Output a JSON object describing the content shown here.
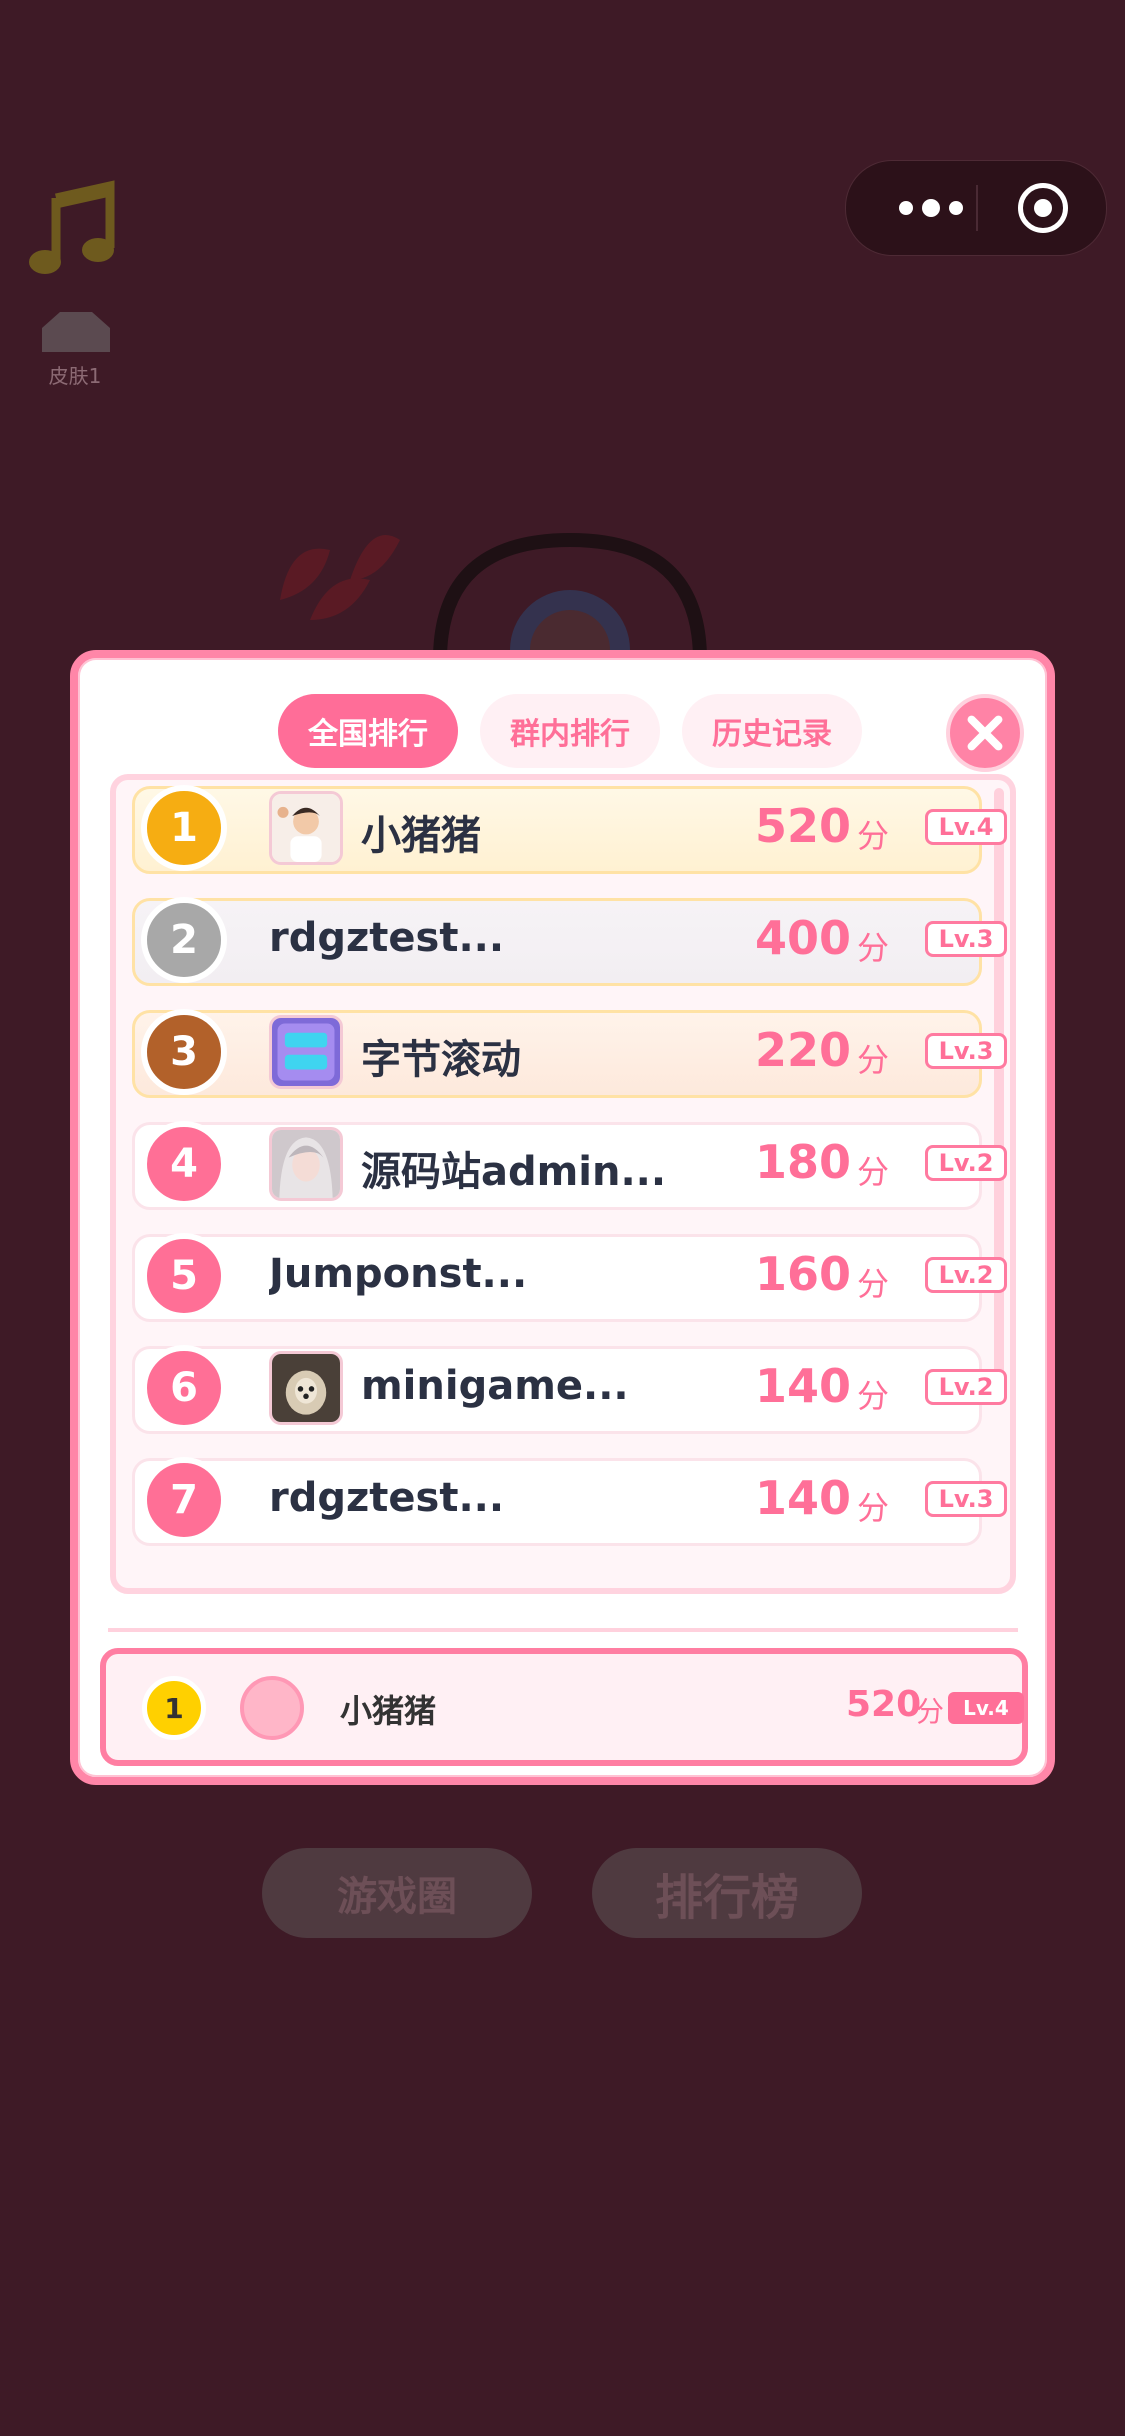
{
  "background": {
    "skin_label": "皮肤1"
  },
  "capsule": {
    "more_icon": "more-dots-icon",
    "close_icon": "target-close-icon"
  },
  "modal": {
    "tabs": [
      {
        "label": "全国排行",
        "active": true
      },
      {
        "label": "群内排行",
        "active": false
      },
      {
        "label": "历史记录",
        "active": false
      }
    ],
    "close_icon": "close-x-icon",
    "score_unit": "分",
    "rows": [
      {
        "rank": "1",
        "name": "小猪猪",
        "score": "520",
        "level": "Lv.4",
        "has_avatar": true
      },
      {
        "rank": "2",
        "name": "rdgztest...",
        "score": "400",
        "level": "Lv.3",
        "has_avatar": false
      },
      {
        "rank": "3",
        "name": "字节滚动",
        "score": "220",
        "level": "Lv.3",
        "has_avatar": true
      },
      {
        "rank": "4",
        "name": "源码站admin...",
        "score": "180",
        "level": "Lv.2",
        "has_avatar": true
      },
      {
        "rank": "5",
        "name": "Jumponst...",
        "score": "160",
        "level": "Lv.2",
        "has_avatar": false
      },
      {
        "rank": "6",
        "name": "minigame...",
        "score": "140",
        "level": "Lv.2",
        "has_avatar": true
      },
      {
        "rank": "7",
        "name": "rdgztest...",
        "score": "140",
        "level": "Lv.3",
        "has_avatar": false
      }
    ],
    "my_rank": {
      "rank": "1",
      "name": "小猪猪",
      "score": "520",
      "unit": "分",
      "level": "Lv.4"
    }
  },
  "bottom_buttons": {
    "game_circle": "游戏圈",
    "leaderboard": "排行榜"
  },
  "colors": {
    "background": "#3e1a26",
    "accent_pink": "#ff6f98",
    "gold": "#f6ad12",
    "silver": "#a8a8a8",
    "bronze": "#b2612a"
  }
}
